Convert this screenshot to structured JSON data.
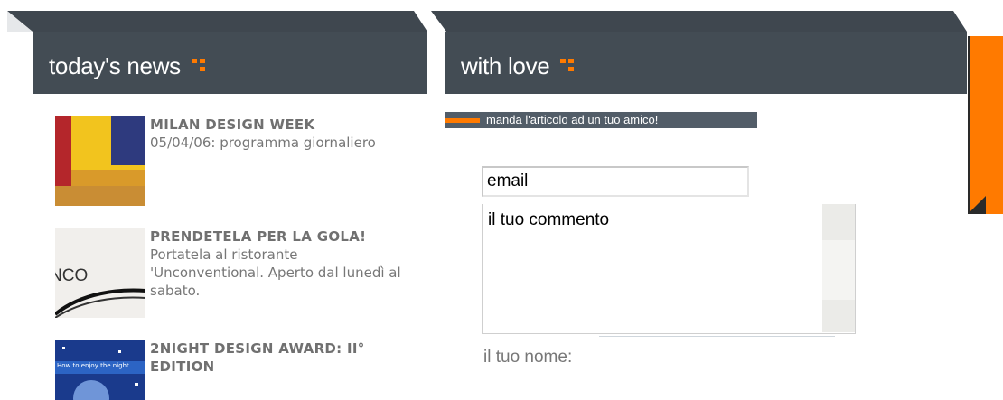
{
  "news_panel": {
    "title": "today's news",
    "items": [
      {
        "title": "MILAN DESIGN WEEK",
        "text": "05/04/06: programma giornaliero"
      },
      {
        "title": "PRENDETELA PER LA GOLA!",
        "text": "Portatela al ristorante 'Unconventional. Aperto dal lunedì al sabato.",
        "thumb_text": "NCO"
      },
      {
        "title": "2NIGHT DESIGN AWARD: II° EDITION",
        "text": "",
        "thumb_text": "How to enjoy the night"
      }
    ]
  },
  "love_panel": {
    "title": "with love",
    "send_banner": "manda l'articolo ad un tuo amico!",
    "email_value": "email",
    "comment_placeholder": "il tuo commento",
    "name_label": "il tuo nome:"
  },
  "colors": {
    "header_bg": "#434c54",
    "accent": "#ff7a00"
  }
}
